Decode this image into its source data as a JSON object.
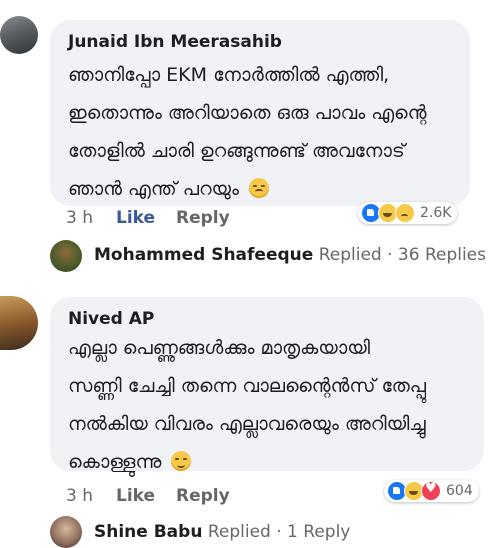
{
  "comments": [
    {
      "author": "Junaid Ibn Meerasahib",
      "lines": [
        "ഞാനിപ്പോ EKM നോർത്തിൽ എത്തി,",
        "ഇതൊന്നും അറിയാതെ ഒരു പാവം എന്റെ",
        "തോളിൽ ചാരി ഉറങ്ങുന്നുണ്ട് അവനോട്",
        "ഞാൻ എന്ത് പറയും"
      ],
      "emoji": "persevering-face",
      "time": "3 h",
      "like_label": "Like",
      "reply_label": "Reply",
      "reactions": [
        "like",
        "haha",
        "sad"
      ],
      "reaction_count": "2.6K",
      "replied_by": "Mohammed Shafeeque",
      "replied_text": " Replied · 36 Replies"
    },
    {
      "author": "Nived AP",
      "lines": [
        "എല്ലാ പെണ്ണുങ്ങൾക്കും മാതൃകയായി",
        "സണ്ണി ചേച്ചി തന്നെ വാലന്റൈൻസ് തേപ്പു",
        "നൽകിയ വിവരം എല്ലാവരെയും അറിയിച്ചു",
        "കൊള്ളുന്നു"
      ],
      "emoji": "grinning-face",
      "time": "3 h",
      "like_label": "Like",
      "reply_label": "Reply",
      "reactions": [
        "like",
        "haha",
        "love"
      ],
      "reaction_count": "604",
      "replied_by": "Shine Babu",
      "replied_text": " Replied · 1 Reply"
    }
  ],
  "colors": {
    "bubble": "#f0f2f5",
    "like_active": "#385898",
    "secondary_text": "#65676b",
    "like_reaction": "#1877f2",
    "love_reaction": "#f33e58"
  }
}
